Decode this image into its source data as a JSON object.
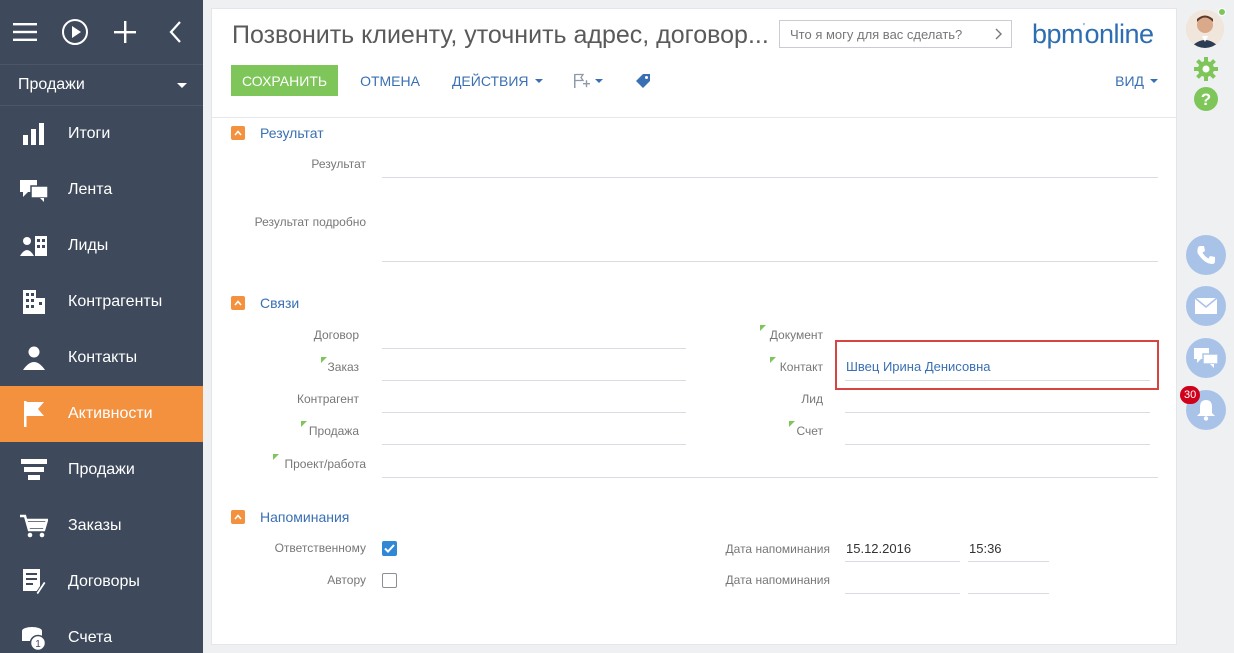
{
  "sidebar": {
    "section_label": "Продажи",
    "items": [
      {
        "label": "Итоги",
        "icon": "bar-chart-icon"
      },
      {
        "label": "Лента",
        "icon": "feed-icon"
      },
      {
        "label": "Лиды",
        "icon": "leads-icon"
      },
      {
        "label": "Контрагенты",
        "icon": "accounts-icon"
      },
      {
        "label": "Контакты",
        "icon": "contact-icon"
      },
      {
        "label": "Активности",
        "icon": "flag-icon",
        "active": true
      },
      {
        "label": "Продажи",
        "icon": "funnel-icon"
      },
      {
        "label": "Заказы",
        "icon": "cart-icon"
      },
      {
        "label": "Договоры",
        "icon": "contract-icon"
      },
      {
        "label": "Счета",
        "icon": "invoice-icon"
      }
    ]
  },
  "header": {
    "title": "Позвонить клиенту, уточнить адрес, договор...",
    "search_placeholder": "Что я могу для вас сделать?",
    "logo": "bpm'online"
  },
  "toolbar": {
    "save_label": "СОХРАНИТЬ",
    "cancel_label": "ОТМЕНА",
    "actions_label": "ДЕЙСТВИЯ",
    "view_label": "ВИД"
  },
  "result_section": {
    "title": "Результат",
    "result_label": "Результат",
    "result_detail_label": "Результат подробно"
  },
  "links_section": {
    "title": "Связи",
    "contract_label": "Договор",
    "order_label": "Заказ",
    "account_label": "Контрагент",
    "opportunity_label": "Продажа",
    "project_label": "Проект/работа",
    "document_label": "Документ",
    "contact_label": "Контакт",
    "contact_value": "Швец Ирина Денисовна",
    "lead_label": "Лид",
    "invoice_label": "Счет"
  },
  "reminders_section": {
    "title": "Напоминания",
    "responsible_label": "Ответственному",
    "responsible_checked": true,
    "author_label": "Автору",
    "author_checked": false,
    "reminder_date_label_1": "Дата напоминания",
    "reminder_date_1": "15.12.2016",
    "reminder_time_1": "15:36",
    "reminder_date_label_2": "Дата напоминания"
  },
  "rail": {
    "notification_count": "30"
  },
  "colors": {
    "sidebar_bg": "#3e4a5b",
    "accent_orange": "#f3913f",
    "save_green": "#7ec65a",
    "link_blue": "#3a70b3",
    "highlight_red": "#d64541"
  }
}
